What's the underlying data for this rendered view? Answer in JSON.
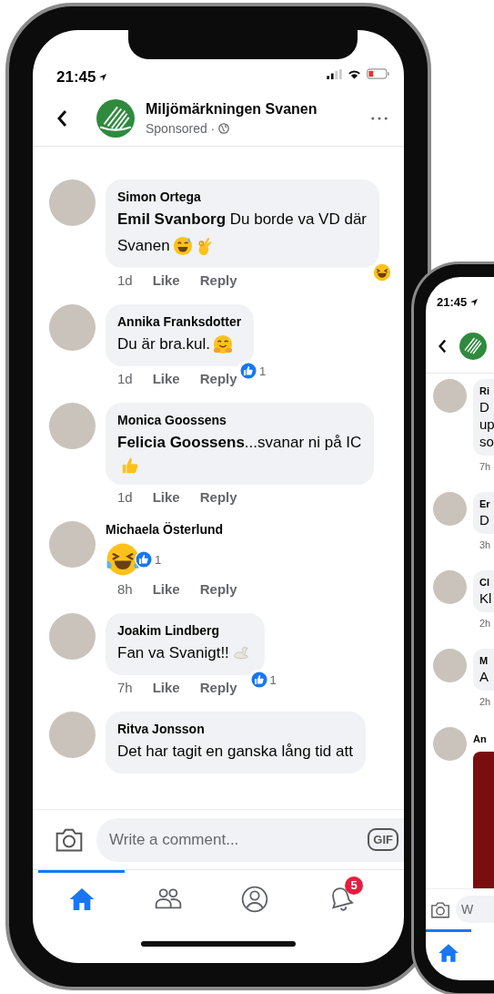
{
  "main_phone": {
    "status_time": "21:45",
    "header": {
      "page_name": "Miljömärkningen Svanen",
      "subtitle": "Sponsored ·"
    },
    "comments": [
      {
        "kind": "text",
        "author": "Simon Ortega",
        "lines": [
          {
            "text": "**Emil Svanborg** Du borde va VD där"
          },
          {
            "text": "Svanen",
            "emojis": [
              {
                "kind": "sweat-smile"
              },
              {
                "kind": "ok-hand"
              }
            ]
          }
        ],
        "time": "1d",
        "like": "Like",
        "reply": "Reply",
        "reaction": {
          "kind": "haha"
        }
      },
      {
        "kind": "text",
        "author": "Annika Franksdotter",
        "lines": [
          {
            "text": "Du är bra.kul.",
            "emojis": [
              {
                "kind": "hugging"
              }
            ]
          }
        ],
        "time": "1d",
        "like": "Like",
        "reply": "Reply",
        "reaction": {
          "kind": "like",
          "count": "1"
        }
      },
      {
        "kind": "text",
        "author": "Monica Goossens",
        "lines": [
          {
            "text": "**Felicia Goossens**...svanar ni på IC"
          },
          {
            "emojis": [
              {
                "kind": "thumbs-up"
              }
            ]
          }
        ],
        "time": "1d",
        "like": "Like",
        "reply": "Reply"
      },
      {
        "kind": "emoji-only",
        "author": "Michaela Österlund",
        "emojis": [
          {
            "kind": "joy"
          }
        ],
        "time": "8h",
        "like": "Like",
        "reply": "Reply",
        "reaction": {
          "kind": "like",
          "count": "1"
        }
      },
      {
        "kind": "text",
        "author": "Joakim Lindberg",
        "lines": [
          {
            "text": "Fan va Svanigt!!",
            "emojis": [
              {
                "kind": "swan"
              }
            ]
          }
        ],
        "time": "7h",
        "like": "Like",
        "reply": "Reply",
        "reaction": {
          "kind": "like",
          "count": "1"
        }
      },
      {
        "kind": "text",
        "author": "Ritva Jonsson",
        "lines": [
          {
            "text": "Det har tagit en ganska lång tid att"
          }
        ]
      }
    ],
    "composer": {
      "placeholder": "Write a comment...",
      "gif": "GIF"
    },
    "tabs": [
      {
        "kind": "home",
        "selected": true
      },
      {
        "kind": "friends",
        "selected": false
      },
      {
        "kind": "profile",
        "selected": false
      },
      {
        "kind": "notifications",
        "selected": false,
        "badge": "5"
      }
    ]
  },
  "second_phone": {
    "status_time": "21:45",
    "comments": [
      {
        "kind": "text",
        "author": "Ri",
        "lines": [
          "D",
          "up",
          "so"
        ],
        "time": "7h"
      },
      {
        "kind": "text",
        "author": "Er",
        "lines": [
          "D"
        ],
        "time": "3h"
      },
      {
        "kind": "text",
        "author": "Cl",
        "lines": [
          "Kl"
        ],
        "time": "2h"
      },
      {
        "kind": "text",
        "author": "M",
        "lines": [
          "A"
        ],
        "time": "2h"
      },
      {
        "kind": "photo",
        "author": "An"
      }
    ],
    "composer": {
      "placeholder": "W"
    },
    "tabs": [
      {
        "kind": "home",
        "selected": true
      }
    ]
  }
}
